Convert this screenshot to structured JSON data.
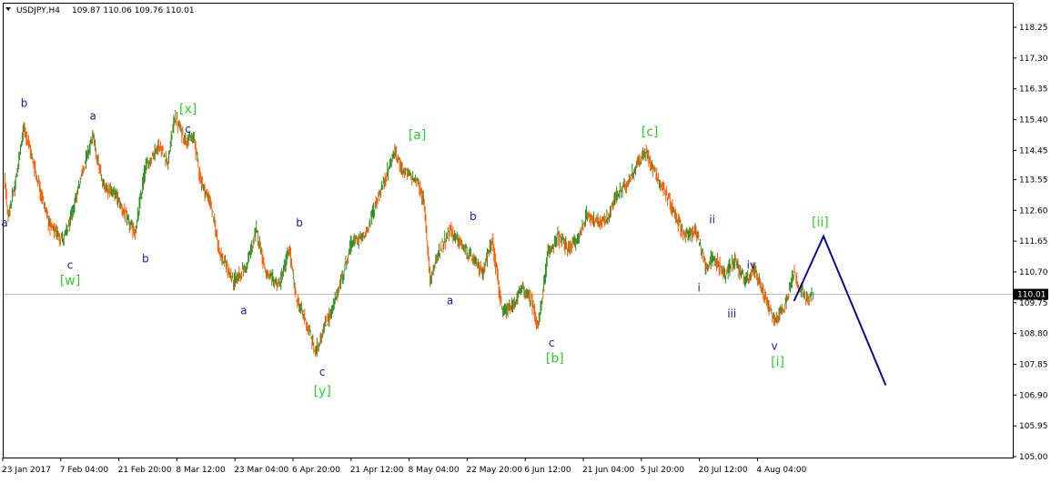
{
  "header": {
    "symbol": "USDJPY,H4",
    "ohlc": "109.87 110.06 109.76 110.01"
  },
  "colors": {
    "background": "#ffffff",
    "frame": "#000000",
    "bull": "#2e8b1e",
    "bear": "#ff5a00",
    "bid_line": "#c0c0c0",
    "projection": "#0a0a8c",
    "wave_blue": "#1a1aa6",
    "wave_green": "#2ecc2e",
    "price_tag": "#000000",
    "price_tag_text": "#ffffff"
  },
  "chart_data": {
    "type": "candlestick",
    "x_dates": [
      "23 Jan 2017",
      "7 Feb 04:00",
      "21 Feb 20:00",
      "8 Mar 12:00",
      "23 Mar 04:00",
      "6 Apr 20:00",
      "21 Apr 12:00",
      "8 May 04:00",
      "22 May 20:00",
      "6 Jun 12:00",
      "21 Jun 04:00",
      "5 Jul 20:00",
      "20 Jul 12:00",
      "4 Aug 04:00"
    ],
    "y_ticks": [
      "118.25",
      "117.30",
      "116.35",
      "115.40",
      "114.45",
      "113.55",
      "112.60",
      "111.65",
      "110.70",
      "109.75",
      "108.80",
      "107.85",
      "106.90",
      "105.95",
      "105.00"
    ],
    "ylim": [
      105.0,
      118.25
    ],
    "grid": false,
    "current_price": "110.01",
    "price_path": [
      {
        "x": 0,
        "y": 113.7
      },
      {
        "x": 1,
        "y": 112.4
      },
      {
        "x": 3,
        "y": 113.2
      },
      {
        "x": 6,
        "y": 115.2
      },
      {
        "x": 10,
        "y": 113.6
      },
      {
        "x": 14,
        "y": 112.1
      },
      {
        "x": 18,
        "y": 111.7
      },
      {
        "x": 20,
        "y": 112.2
      },
      {
        "x": 24,
        "y": 113.9
      },
      {
        "x": 27,
        "y": 114.9
      },
      {
        "x": 30,
        "y": 113.4
      },
      {
        "x": 34,
        "y": 113.1
      },
      {
        "x": 38,
        "y": 112.2
      },
      {
        "x": 40,
        "y": 111.9
      },
      {
        "x": 43,
        "y": 113.9
      },
      {
        "x": 47,
        "y": 114.6
      },
      {
        "x": 50,
        "y": 114.1
      },
      {
        "x": 52,
        "y": 115.5
      },
      {
        "x": 55,
        "y": 114.8
      },
      {
        "x": 58,
        "y": 114.8
      },
      {
        "x": 60,
        "y": 113.5
      },
      {
        "x": 63,
        "y": 112.8
      },
      {
        "x": 66,
        "y": 111.2
      },
      {
        "x": 70,
        "y": 110.4
      },
      {
        "x": 74,
        "y": 110.9
      },
      {
        "x": 77,
        "y": 112.0
      },
      {
        "x": 80,
        "y": 110.6
      },
      {
        "x": 84,
        "y": 110.3
      },
      {
        "x": 87,
        "y": 111.4
      },
      {
        "x": 89,
        "y": 109.9
      },
      {
        "x": 92,
        "y": 109.2
      },
      {
        "x": 95,
        "y": 108.2
      },
      {
        "x": 98,
        "y": 109.1
      },
      {
        "x": 100,
        "y": 109.5
      },
      {
        "x": 103,
        "y": 110.5
      },
      {
        "x": 106,
        "y": 111.6
      },
      {
        "x": 110,
        "y": 111.8
      },
      {
        "x": 113,
        "y": 112.7
      },
      {
        "x": 116,
        "y": 113.5
      },
      {
        "x": 119,
        "y": 114.4
      },
      {
        "x": 122,
        "y": 113.8
      },
      {
        "x": 126,
        "y": 113.5
      },
      {
        "x": 128,
        "y": 112.9
      },
      {
        "x": 130,
        "y": 110.5
      },
      {
        "x": 133,
        "y": 111.4
      },
      {
        "x": 136,
        "y": 112.0
      },
      {
        "x": 139,
        "y": 111.6
      },
      {
        "x": 142,
        "y": 111.2
      },
      {
        "x": 146,
        "y": 110.7
      },
      {
        "x": 149,
        "y": 111.7
      },
      {
        "x": 152,
        "y": 109.4
      },
      {
        "x": 155,
        "y": 109.6
      },
      {
        "x": 158,
        "y": 110.2
      },
      {
        "x": 161,
        "y": 109.8
      },
      {
        "x": 163,
        "y": 109.0
      },
      {
        "x": 166,
        "y": 111.3
      },
      {
        "x": 169,
        "y": 111.8
      },
      {
        "x": 172,
        "y": 111.4
      },
      {
        "x": 175,
        "y": 111.7
      },
      {
        "x": 178,
        "y": 112.5
      },
      {
        "x": 181,
        "y": 112.2
      },
      {
        "x": 184,
        "y": 112.3
      },
      {
        "x": 187,
        "y": 113.1
      },
      {
        "x": 190,
        "y": 113.4
      },
      {
        "x": 193,
        "y": 114.0
      },
      {
        "x": 196,
        "y": 114.4
      },
      {
        "x": 199,
        "y": 113.7
      },
      {
        "x": 202,
        "y": 113.1
      },
      {
        "x": 205,
        "y": 112.4
      },
      {
        "x": 208,
        "y": 111.8
      },
      {
        "x": 211,
        "y": 112.0
      },
      {
        "x": 214,
        "y": 110.9
      },
      {
        "x": 217,
        "y": 111.1
      },
      {
        "x": 220,
        "y": 110.6
      },
      {
        "x": 223,
        "y": 111.1
      },
      {
        "x": 226,
        "y": 110.4
      },
      {
        "x": 229,
        "y": 110.8
      },
      {
        "x": 232,
        "y": 110.0
      },
      {
        "x": 235,
        "y": 109.2
      },
      {
        "x": 238,
        "y": 109.6
      },
      {
        "x": 241,
        "y": 110.7
      },
      {
        "x": 243,
        "y": 110.2
      },
      {
        "x": 245,
        "y": 109.8
      },
      {
        "x": 247,
        "y": 110.0
      }
    ],
    "wave_labels_blue": [
      {
        "text": "a",
        "x": 0,
        "y": 112.1
      },
      {
        "text": "b",
        "x": 6,
        "y": 115.8
      },
      {
        "text": "a",
        "x": 27,
        "y": 115.4
      },
      {
        "text": "c",
        "x": 20,
        "y": 110.8
      },
      {
        "text": "b",
        "x": 43,
        "y": 111.0
      },
      {
        "text": "c",
        "x": 56,
        "y": 115.0
      },
      {
        "text": "a",
        "x": 73,
        "y": 109.4
      },
      {
        "text": "b",
        "x": 90,
        "y": 112.1
      },
      {
        "text": "c",
        "x": 97,
        "y": 107.5
      },
      {
        "text": "a",
        "x": 136,
        "y": 109.7
      },
      {
        "text": "b",
        "x": 143,
        "y": 112.3
      },
      {
        "text": "c",
        "x": 167,
        "y": 108.4
      },
      {
        "text": "i",
        "x": 212,
        "y": 110.1
      },
      {
        "text": "ii",
        "x": 216,
        "y": 112.2
      },
      {
        "text": "iii",
        "x": 222,
        "y": 109.3
      },
      {
        "text": "iv",
        "x": 228,
        "y": 110.8
      },
      {
        "text": "v",
        "x": 235,
        "y": 108.3
      }
    ],
    "wave_labels_green": [
      {
        "text": "[w]",
        "x": 20,
        "y": 110.3
      },
      {
        "text": "[x]",
        "x": 56,
        "y": 115.6
      },
      {
        "text": "[y]",
        "x": 97,
        "y": 106.9
      },
      {
        "text": "[a]",
        "x": 126,
        "y": 114.8
      },
      {
        "text": "[b]",
        "x": 168,
        "y": 107.9
      },
      {
        "text": "[c]",
        "x": 197,
        "y": 114.9
      },
      {
        "text": "[ii]",
        "x": 249,
        "y": 112.1
      },
      {
        "text": "[i]",
        "x": 236,
        "y": 107.8
      }
    ],
    "projection": [
      {
        "x": 241,
        "y": 109.8
      },
      {
        "x": 250,
        "y": 111.8
      },
      {
        "x": 269,
        "y": 107.2
      }
    ]
  }
}
